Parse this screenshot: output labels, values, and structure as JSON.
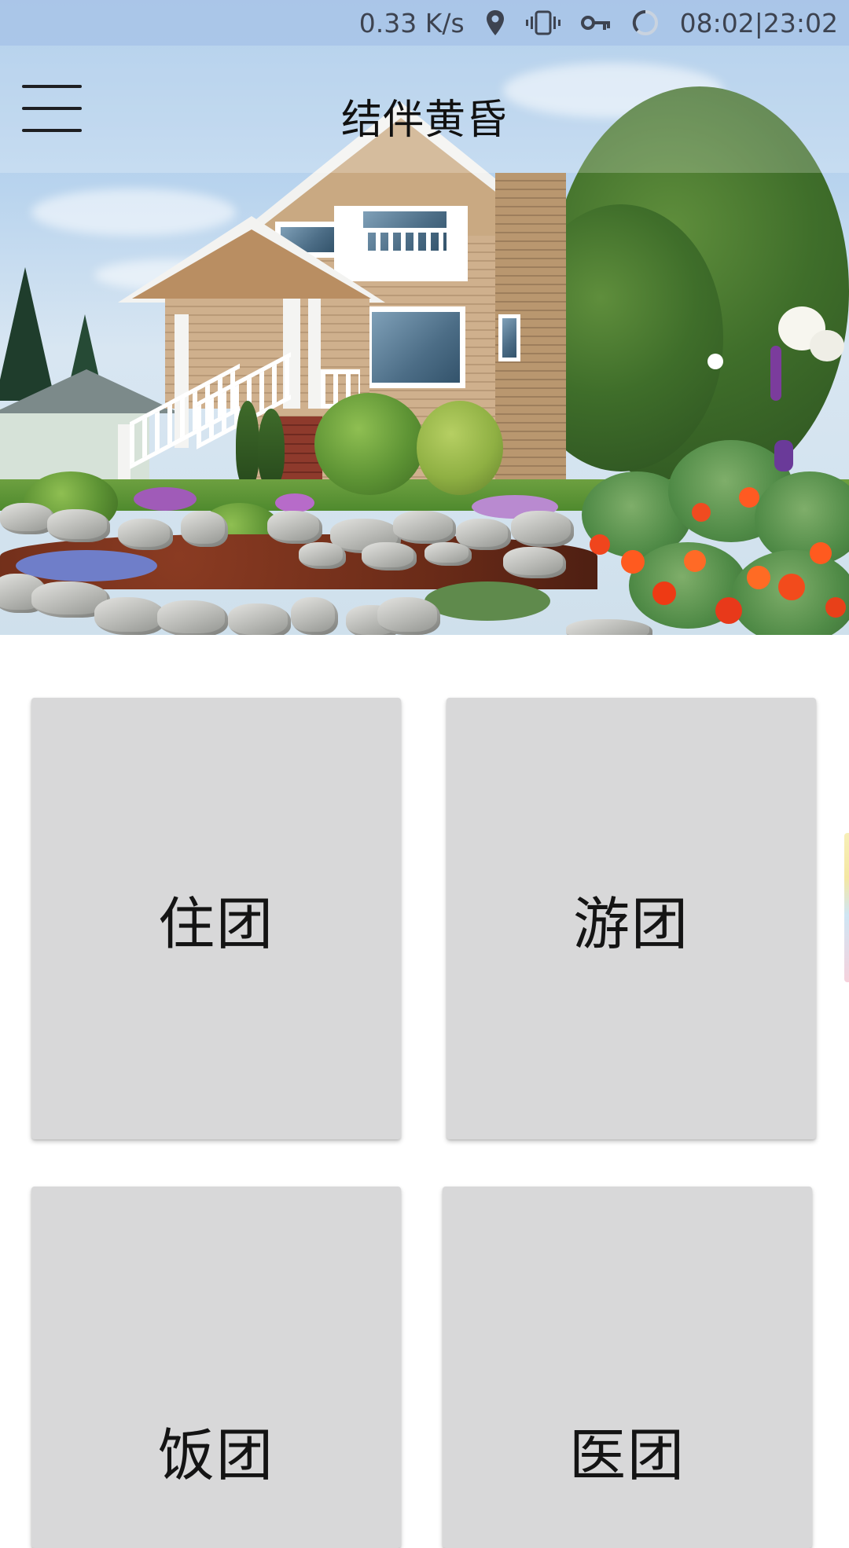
{
  "status_bar": {
    "net_speed": "0.33 K/s",
    "location_icon": "location-pin-icon",
    "vibrate_icon": "vibrate-icon",
    "vpn_icon": "key-icon",
    "sync_icon": "loading-ring-icon",
    "time": "08:02|23:02"
  },
  "app_bar": {
    "menu_icon": "hamburger-menu-icon",
    "title": "结伴黄昏"
  },
  "hero": {
    "image": "house-with-garden-photo"
  },
  "tiles": [
    {
      "label": "住团"
    },
    {
      "label": "游团"
    },
    {
      "label": "饭团"
    },
    {
      "label": "医团"
    }
  ],
  "colors": {
    "status_bar_bg": "#aac6e8",
    "tile_bg": "#d8d8d9",
    "text": "#141414",
    "page_bg": "#ffffff"
  }
}
